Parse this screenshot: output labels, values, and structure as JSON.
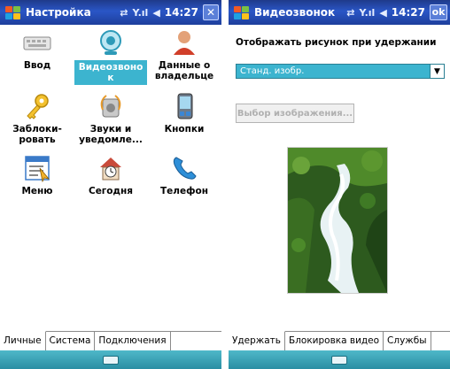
{
  "left": {
    "title": "Настройка",
    "clock": "14:27",
    "close_label": "✕",
    "items": [
      {
        "label": "Ввод",
        "icon": "keyboard-icon"
      },
      {
        "label": "Видеозвоно к",
        "icon": "video-call-icon",
        "selected": true
      },
      {
        "label": "Данные о владельце",
        "icon": "owner-icon"
      },
      {
        "label": "Заблоки- ровать",
        "icon": "key-icon"
      },
      {
        "label": "Звуки и уведомле...",
        "icon": "sounds-icon"
      },
      {
        "label": "Кнопки",
        "icon": "buttons-icon"
      },
      {
        "label": "Меню",
        "icon": "menu-icon"
      },
      {
        "label": "Сегодня",
        "icon": "today-icon"
      },
      {
        "label": "Телефон",
        "icon": "phone-icon"
      }
    ],
    "tabs": [
      "Личные",
      "Система",
      "Подключения"
    ]
  },
  "right": {
    "title": "Видеозвонок",
    "clock": "14:27",
    "ok_label": "ok",
    "option_label": "Отображать рисунок при удержании",
    "dropdown_value": "Станд. изобр.",
    "pick_button": "Выбор изображения...",
    "tabs": [
      "Удержать",
      "Блокировка видео",
      "Службы"
    ]
  },
  "colors": {
    "titlebar": "#2a56c6",
    "accent": "#3cb4cf",
    "softbar": "#2a8ea3"
  }
}
